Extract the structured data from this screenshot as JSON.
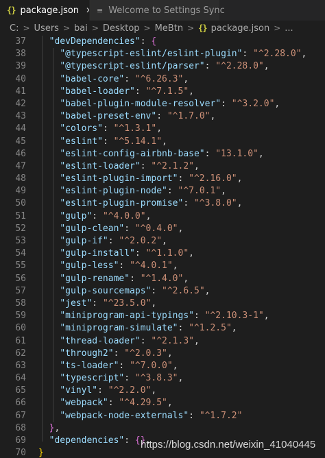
{
  "tabs": [
    {
      "icon": "{}",
      "label": "package.json",
      "close": "✕",
      "active": true
    },
    {
      "icon": "≡",
      "label": "Welcome to Settings Sync",
      "active": false
    }
  ],
  "breadcrumb": {
    "parts": [
      "C:",
      "Users",
      "bai",
      "Desktop",
      "MeBtn"
    ],
    "file_icon": "{}",
    "file": "package.json",
    "tail": "..."
  },
  "code_lines": [
    {
      "n": "37",
      "indent": "  ",
      "key": "\"devDependencies\"",
      "after": ": ",
      "open": "{",
      "open_color": "b2"
    },
    {
      "n": "38",
      "indent": "    ",
      "key": "\"@typescript-eslint/eslint-plugin\"",
      "after": ": ",
      "value": "\"^2.28.0\"",
      "tail": ","
    },
    {
      "n": "39",
      "indent": "    ",
      "key": "\"@typescript-eslint/parser\"",
      "after": ": ",
      "value": "\"^2.28.0\"",
      "tail": ","
    },
    {
      "n": "40",
      "indent": "    ",
      "key": "\"babel-core\"",
      "after": ": ",
      "value": "\"^6.26.3\"",
      "tail": ","
    },
    {
      "n": "41",
      "indent": "    ",
      "key": "\"babel-loader\"",
      "after": ": ",
      "value": "\"^7.1.5\"",
      "tail": ","
    },
    {
      "n": "42",
      "indent": "    ",
      "key": "\"babel-plugin-module-resolver\"",
      "after": ": ",
      "value": "\"^3.2.0\"",
      "tail": ","
    },
    {
      "n": "43",
      "indent": "    ",
      "key": "\"babel-preset-env\"",
      "after": ": ",
      "value": "\"^1.7.0\"",
      "tail": ","
    },
    {
      "n": "44",
      "indent": "    ",
      "key": "\"colors\"",
      "after": ": ",
      "value": "\"^1.3.1\"",
      "tail": ","
    },
    {
      "n": "45",
      "indent": "    ",
      "key": "\"eslint\"",
      "after": ": ",
      "value": "\"^5.14.1\"",
      "tail": ","
    },
    {
      "n": "46",
      "indent": "    ",
      "key": "\"eslint-config-airbnb-base\"",
      "after": ": ",
      "value": "\"13.1.0\"",
      "tail": ","
    },
    {
      "n": "47",
      "indent": "    ",
      "key": "\"eslint-loader\"",
      "after": ": ",
      "value": "\"^2.1.2\"",
      "tail": ","
    },
    {
      "n": "48",
      "indent": "    ",
      "key": "\"eslint-plugin-import\"",
      "after": ": ",
      "value": "\"^2.16.0\"",
      "tail": ","
    },
    {
      "n": "49",
      "indent": "    ",
      "key": "\"eslint-plugin-node\"",
      "after": ": ",
      "value": "\"^7.0.1\"",
      "tail": ","
    },
    {
      "n": "50",
      "indent": "    ",
      "key": "\"eslint-plugin-promise\"",
      "after": ": ",
      "value": "\"^3.8.0\"",
      "tail": ","
    },
    {
      "n": "51",
      "indent": "    ",
      "key": "\"gulp\"",
      "after": ": ",
      "value": "\"^4.0.0\"",
      "tail": ","
    },
    {
      "n": "52",
      "indent": "    ",
      "key": "\"gulp-clean\"",
      "after": ": ",
      "value": "\"^0.4.0\"",
      "tail": ","
    },
    {
      "n": "53",
      "indent": "    ",
      "key": "\"gulp-if\"",
      "after": ": ",
      "value": "\"^2.0.2\"",
      "tail": ","
    },
    {
      "n": "54",
      "indent": "    ",
      "key": "\"gulp-install\"",
      "after": ": ",
      "value": "\"^1.1.0\"",
      "tail": ","
    },
    {
      "n": "55",
      "indent": "    ",
      "key": "\"gulp-less\"",
      "after": ": ",
      "value": "\"^4.0.1\"",
      "tail": ","
    },
    {
      "n": "56",
      "indent": "    ",
      "key": "\"gulp-rename\"",
      "after": ": ",
      "value": "\"^1.4.0\"",
      "tail": ","
    },
    {
      "n": "57",
      "indent": "    ",
      "key": "\"gulp-sourcemaps\"",
      "after": ": ",
      "value": "\"^2.6.5\"",
      "tail": ","
    },
    {
      "n": "58",
      "indent": "    ",
      "key": "\"jest\"",
      "after": ": ",
      "value": "\"^23.5.0\"",
      "tail": ","
    },
    {
      "n": "59",
      "indent": "    ",
      "key": "\"miniprogram-api-typings\"",
      "after": ": ",
      "value": "\"^2.10.3-1\"",
      "tail": ","
    },
    {
      "n": "60",
      "indent": "    ",
      "key": "\"miniprogram-simulate\"",
      "after": ": ",
      "value": "\"^1.2.5\"",
      "tail": ","
    },
    {
      "n": "61",
      "indent": "    ",
      "key": "\"thread-loader\"",
      "after": ": ",
      "value": "\"^2.1.3\"",
      "tail": ","
    },
    {
      "n": "62",
      "indent": "    ",
      "key": "\"through2\"",
      "after": ": ",
      "value": "\"^2.0.3\"",
      "tail": ","
    },
    {
      "n": "63",
      "indent": "    ",
      "key": "\"ts-loader\"",
      "after": ": ",
      "value": "\"^7.0.0\"",
      "tail": ","
    },
    {
      "n": "64",
      "indent": "    ",
      "key": "\"typescript\"",
      "after": ": ",
      "value": "\"^3.8.3\"",
      "tail": ","
    },
    {
      "n": "65",
      "indent": "    ",
      "key": "\"vinyl\"",
      "after": ": ",
      "value": "\"^2.2.0\"",
      "tail": ","
    },
    {
      "n": "66",
      "indent": "    ",
      "key": "\"webpack\"",
      "after": ": ",
      "value": "\"^4.29.5\"",
      "tail": ","
    },
    {
      "n": "67",
      "indent": "    ",
      "key": "\"webpack-node-externals\"",
      "after": ": ",
      "value": "\"^1.7.2\"",
      "tail": ""
    },
    {
      "n": "68",
      "indent": "  ",
      "close": "}",
      "close_color": "b2",
      "tail": ","
    },
    {
      "n": "69",
      "indent": "  ",
      "key": "\"dependencies\"",
      "after": ": ",
      "open": "{}",
      "open_color": "b2",
      "tail": ","
    },
    {
      "n": "70",
      "indent": "",
      "close": "}",
      "close_color": "b1"
    }
  ],
  "watermark": "https://blog.csdn.net/weixin_41040445",
  "colors": {
    "background": "#1e1e1e",
    "key": "#9cdcfe",
    "string": "#ce9178",
    "line_number": "#858585",
    "json_icon": "#cbcb41"
  }
}
